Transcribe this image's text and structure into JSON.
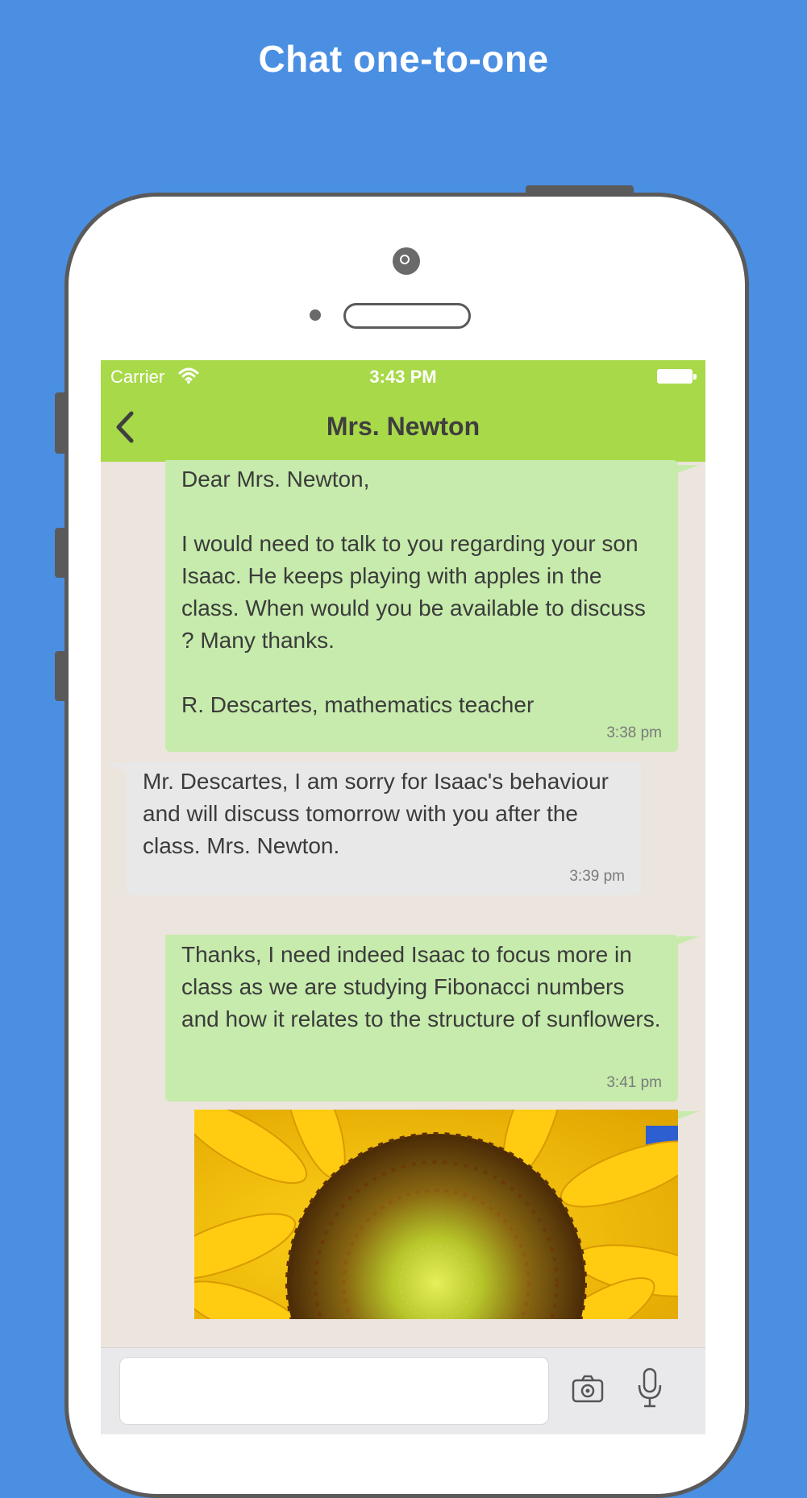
{
  "headline": "Chat one-to-one",
  "status_bar": {
    "carrier": "Carrier",
    "time": "3:43 PM"
  },
  "nav": {
    "title": "Mrs. Newton"
  },
  "messages": [
    {
      "direction": "outgoing",
      "text": "Dear Mrs. Newton,\n\nI would need to talk to you regarding your son Isaac. He keeps playing with apples in the class. When would you be available to discuss ? Many thanks.\n\nR. Descartes, mathematics teacher",
      "time": "3:38 pm"
    },
    {
      "direction": "incoming",
      "text": "Mr. Descartes, I am sorry for Isaac's behaviour and will discuss tomorrow with you after the class. Mrs. Newton.",
      "time": "3:39 pm"
    },
    {
      "direction": "outgoing",
      "text": "Thanks, I need indeed Isaac to focus more in class as we are studying Fibonacci numbers and how it relates to the structure of sunflowers.",
      "time": "3:41 pm"
    },
    {
      "direction": "outgoing",
      "type": "image",
      "image_subject": "sunflower"
    }
  ],
  "input": {
    "placeholder": ""
  },
  "icons": {
    "back": "chevron-left-icon",
    "wifi": "wifi-icon",
    "battery": "battery-icon",
    "camera": "camera-icon",
    "microphone": "microphone-icon"
  },
  "colors": {
    "background": "#4A8FE2",
    "nav_bar": "#A8D949",
    "outgoing_bubble": "#C6EBAC",
    "incoming_bubble": "#E8E8E8",
    "chat_background": "#ECE5DD"
  }
}
